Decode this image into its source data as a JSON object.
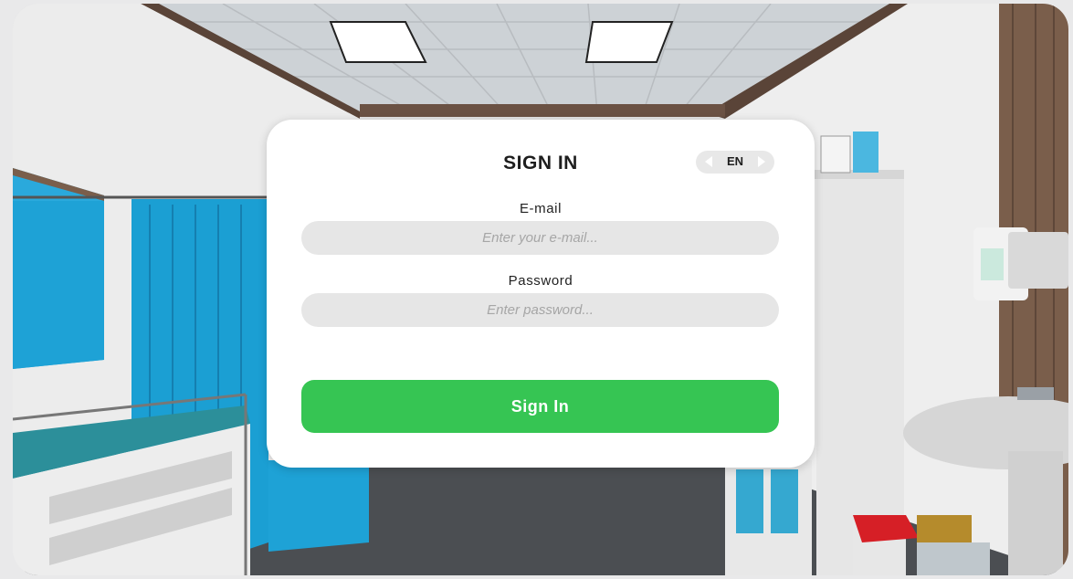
{
  "signin": {
    "title": "SIGN IN",
    "language": "EN",
    "email_label": "E-mail",
    "email_placeholder": "Enter your e-mail...",
    "email_value": "",
    "password_label": "Password",
    "password_placeholder": "Enter password...",
    "password_value": "",
    "submit_label": "Sign In"
  },
  "colors": {
    "accent": "#36c553",
    "card": "#ffffff",
    "field": "#e6e6e6",
    "curtain": "#1ea2d6"
  },
  "icons": [
    "chevron-left-icon",
    "chevron-right-icon"
  ]
}
